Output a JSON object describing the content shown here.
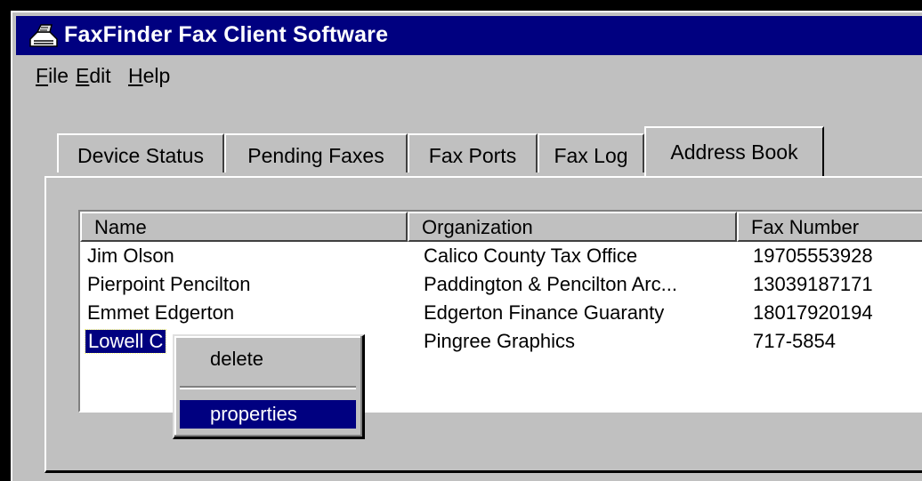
{
  "window": {
    "title": "FaxFinder Fax Client Software",
    "icon": "fax-machine-icon"
  },
  "menu": {
    "file": "File",
    "edit": "Edit",
    "help": "Help"
  },
  "tabs": [
    {
      "label": "Device Status"
    },
    {
      "label": "Pending Faxes"
    },
    {
      "label": "Fax Ports"
    },
    {
      "label": "Fax Log"
    },
    {
      "label": "Address Book",
      "active": true
    }
  ],
  "address_book": {
    "columns": [
      "Name",
      "Organization",
      "Fax Number"
    ],
    "rows": [
      {
        "name": "Jim Olson",
        "organization": "Calico County Tax Office",
        "fax": "19705553928"
      },
      {
        "name": "Pierpoint Pencilton",
        "organization": "Paddington & Pencilton Arc...",
        "fax": "13039187171"
      },
      {
        "name": "Emmet Edgerton",
        "organization": "Edgerton Finance Guaranty",
        "fax": "18017920194"
      },
      {
        "name": "Lowell C",
        "organization": "Pingree Graphics",
        "fax": "717-5854",
        "selected": true
      }
    ]
  },
  "context_menu": {
    "items": [
      "delete",
      "properties"
    ],
    "highlighted": "properties"
  },
  "colors": {
    "titlebar": "#000080",
    "face": "#c0c0c0",
    "selection": "#000080"
  }
}
